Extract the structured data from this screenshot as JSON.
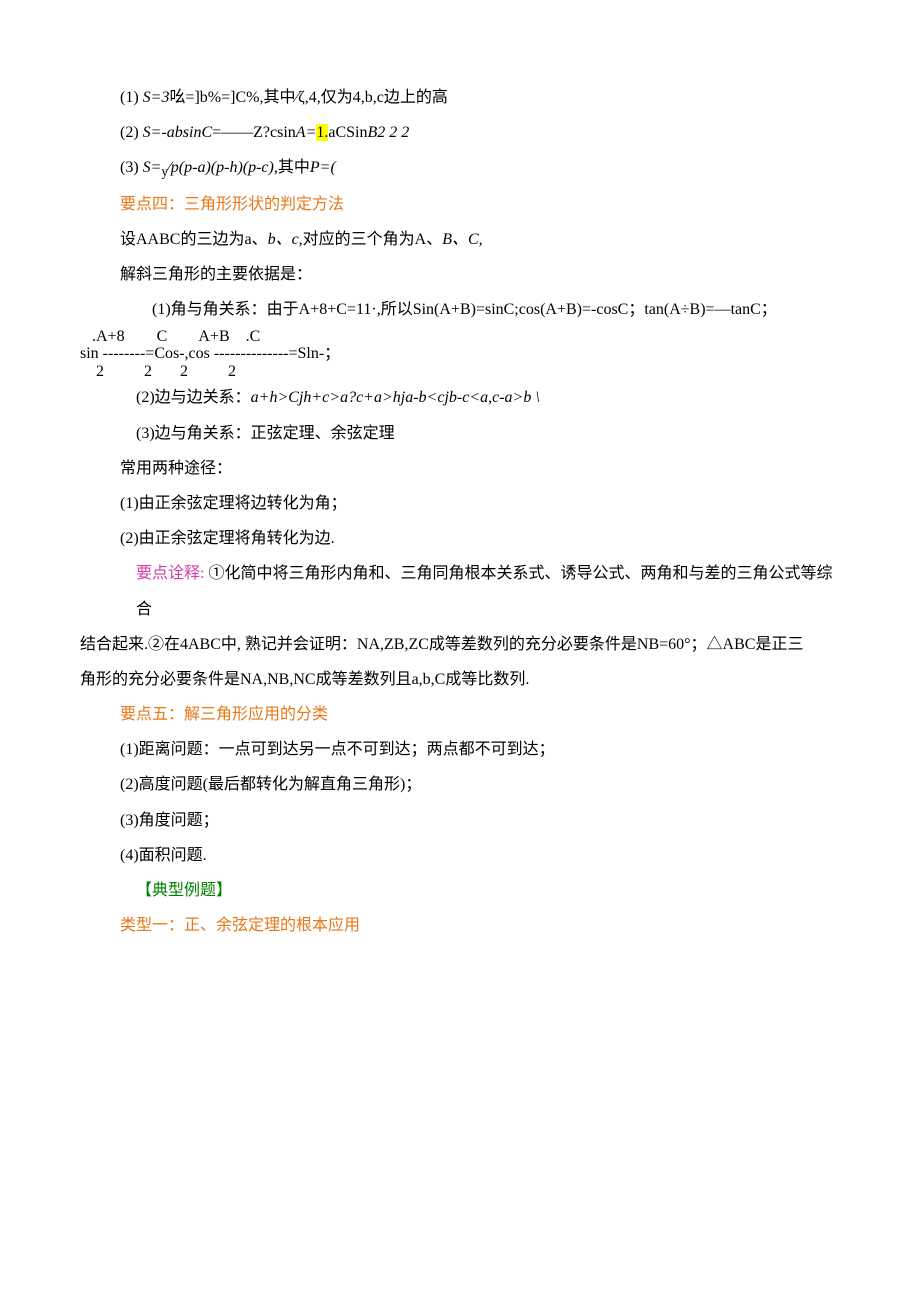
{
  "p1": {
    "pre": "(1)  ",
    "body": "S=3",
    "tail": "吆=]b%=]C%,其中∕ζ,4,仅为4,b,c边上的高"
  },
  "p2": {
    "pre": "(2)  ",
    "a": "S=-absinC",
    "b": "=——Z?csin",
    "c": "A=",
    "hl": "1.",
    "d": "aCSin",
    "e": "B2",
    "f": "   2       2"
  },
  "p3": {
    "pre": "(3)  ",
    "a": "S=",
    "sub": "y",
    "b": "∕p(p-a)(p-h)(p-c),",
    "c": "其中",
    "d": "P=("
  },
  "h4": "要点四：三角形形状的判定方法",
  "p4": {
    "a": "设AABC的三边为a、",
    "b": "b、c,",
    "c": "对应的三个角为A、",
    "d": "B、C,"
  },
  "p5": "解斜三角形的主要依据是：",
  "p6": "(1)角与角关系：由于A+8+C=11·,所以Sin(A+B)=sinC;cos(A+B)=-cosC；tan(A÷B)=—tanC；",
  "frac": {
    "top": "   .A+8        C        A+B    .C",
    "mid": "sin --------=Cos-,cos --------------=Sln-；",
    "bot": "    2          2       2          2"
  },
  "p7": {
    "pre": "(2)边与边关系：",
    "body": "a+h>Cjh+c>a?c+a>hja-b<cjb-c<a,c-a>b \\"
  },
  "p8": "(3)边与角关系：正弦定理、余弦定理",
  "p9": "常用两种途径：",
  "p10": "(1)由正余弦定理将边转化为角；",
  "p11": "(2)由正余弦定理将角转化为边.",
  "p12a": "要点诠释:",
  "p12b": "①化简中将三角形内角和、三角同角根本关系式、诱导公式、两角和与差的三角公式等综合",
  "p12c": "结合起来.②在4ABC中, 熟记并会证明：NA,ZB,ZC成等差数列的充分必要条件是NB=60°；△ABC是正三",
  "p12d": "角形的充分必要条件是NA,NB,NC成等差数列且a,b,C成等比数列.",
  "h5": "要点五：解三角形应用的分类",
  "p13": "(1)距离问题：一点可到达另一点不可到达；两点都不可到达；",
  "p14": "(2)高度问题(最后都转化为解直角三角形)；",
  "p15": "(3)角度问题；",
  "p16": "(4)面积问题.",
  "h6": "【典型例题】",
  "h7": "类型一：正、余弦定理的根本应用"
}
